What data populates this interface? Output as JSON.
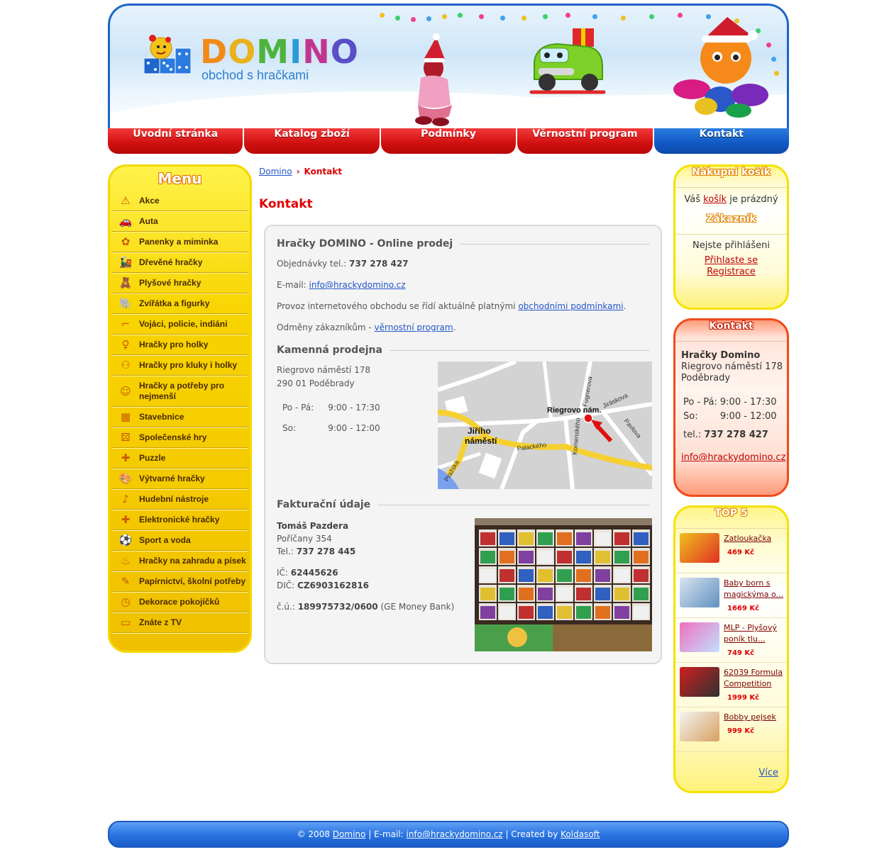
{
  "header": {
    "logo_title": [
      "D",
      "O",
      "M",
      "I",
      "N",
      "O"
    ],
    "logo_subtitle": "obchod s hračkami"
  },
  "nav": [
    {
      "label": "Úvodní stránka",
      "active": false
    },
    {
      "label": "Katalog zboží",
      "active": false
    },
    {
      "label": "Podmínky",
      "active": false
    },
    {
      "label": "Věrnostní program",
      "active": false
    },
    {
      "label": "Kontakt",
      "active": true
    }
  ],
  "menu": {
    "title": "Menu",
    "items": [
      {
        "label": "Akce",
        "icon": "warning-icon"
      },
      {
        "label": "Auta",
        "icon": "car-icon"
      },
      {
        "label": "Panenky a miminka",
        "icon": "rattle-icon"
      },
      {
        "label": "Dřevěné hračky",
        "icon": "train-icon"
      },
      {
        "label": "Plyšové hračky",
        "icon": "teddy-icon"
      },
      {
        "label": "Zvířátka a figurky",
        "icon": "animal-icon"
      },
      {
        "label": "Vojáci, policie, indiáni",
        "icon": "gun-icon"
      },
      {
        "label": "Hračky pro holky",
        "icon": "girl-icon"
      },
      {
        "label": "Hračky pro kluky i holky",
        "icon": "kids-icon"
      },
      {
        "label": "Hračky a potřeby pro nejmenší",
        "icon": "baby-icon"
      },
      {
        "label": "Stavebnice",
        "icon": "bricks-icon"
      },
      {
        "label": "Společenské hry",
        "icon": "dice-icon"
      },
      {
        "label": "Puzzle",
        "icon": "puzzle-icon"
      },
      {
        "label": "Výtvarné hračky",
        "icon": "palette-icon"
      },
      {
        "label": "Hudební nástroje",
        "icon": "music-icon"
      },
      {
        "label": "Elektronické hračky",
        "icon": "gamepad-icon"
      },
      {
        "label": "Sport a voda",
        "icon": "ball-icon"
      },
      {
        "label": "Hračky na zahradu a písek",
        "icon": "bucket-icon"
      },
      {
        "label": "Papírnictví, školní potřeby",
        "icon": "pencil-icon"
      },
      {
        "label": "Dekorace pokojíčků",
        "icon": "clock-icon"
      },
      {
        "label": "Znáte z TV",
        "icon": "tv-icon"
      }
    ]
  },
  "breadcrumb": {
    "home": "Domino",
    "separator": "›",
    "current": "Kontakt"
  },
  "page_title": "Kontakt",
  "online": {
    "heading": "Hračky DOMINO - Online prodej",
    "orders_label": "Objednávky tel.:",
    "orders_phone": "737 278 427",
    "email_label": "E-mail:",
    "email": "info@hrackydomino.cz",
    "terms_text": "Provoz internetového obchodu se řídí aktuálně platnými",
    "terms_link": "obchodními podmínkami",
    "terms_end": ".",
    "rewards_text": "Odměny zákazníkům -",
    "rewards_link": "věrnostní program",
    "rewards_end": "."
  },
  "store": {
    "heading": "Kamenná prodejna",
    "street": "Riegrovo náměstí 178",
    "city": "290 01 Poděbrady",
    "hours": [
      {
        "day": "Po - Pá:",
        "time": "9:00 - 17:30"
      },
      {
        "day": "So:",
        "time": "9:00 - 12:00"
      }
    ],
    "map": {
      "label_main": "Riegrovo nám.",
      "label_square": "Jiřího",
      "label_square2": "náměstí",
      "streets": [
        "Palackého",
        "Pražská",
        "Komenského",
        "Fügnerova",
        "Jiráskova",
        "Pavlova"
      ]
    }
  },
  "billing": {
    "heading": "Fakturační údaje",
    "name": "Tomáš Pazdera",
    "address": "Poříčany 354",
    "tel_label": "Tel.:",
    "tel": "737 278 445",
    "ic_label": "IČ:",
    "ic": "62445626",
    "dic_label": "DIČ:",
    "dic": "CZ6903162816",
    "account_label": "č.ú.:",
    "account": "189975732/0600",
    "bank": "(GE Money Bank)"
  },
  "cart": {
    "title": "Nákupní košík",
    "text_before": "Váš",
    "link": "košík",
    "text_after": "je prázdný"
  },
  "customer": {
    "title": "Zákazník",
    "status": "Nejste přihlášeni",
    "login": "Přihlaste se",
    "register": "Registrace"
  },
  "contact_box": {
    "title": "Kontakt",
    "name": "Hračky Domino",
    "street": "Riegrovo náměstí 178",
    "city": "Poděbrady",
    "hours": [
      {
        "day": "Po - Pá:",
        "time": "9:00 - 17:30"
      },
      {
        "day": "So:",
        "time": "9:00 - 12:00"
      }
    ],
    "tel_label": "tel.:",
    "tel": "737 278 427",
    "email": "info@hrackydomino.cz"
  },
  "top5": {
    "title": "TOP 5",
    "items": [
      {
        "name": "Zatloukačka",
        "price": "469 Kč"
      },
      {
        "name": "Baby born s magickýma o...",
        "price": "1669 Kč"
      },
      {
        "name": "MLP - Plyšový poník tlu...",
        "price": "749 Kč"
      },
      {
        "name": "62039 Formula Competition",
        "price": "1999 Kč"
      },
      {
        "name": "Bobby pejsek",
        "price": "999 Kč"
      }
    ],
    "more": "Více"
  },
  "footer": {
    "copyright": "© 2008",
    "site_link": "Domino",
    "email_label": "| E-mail:",
    "email": "info@hrackydomino.cz",
    "created_label": "| Created by",
    "created_link": "Koldasoft"
  },
  "colors": {
    "nav_red": "#d00f0f",
    "nav_blue": "#1258c4",
    "menu_yellow": "#f8d400",
    "title_red": "#e00000"
  }
}
